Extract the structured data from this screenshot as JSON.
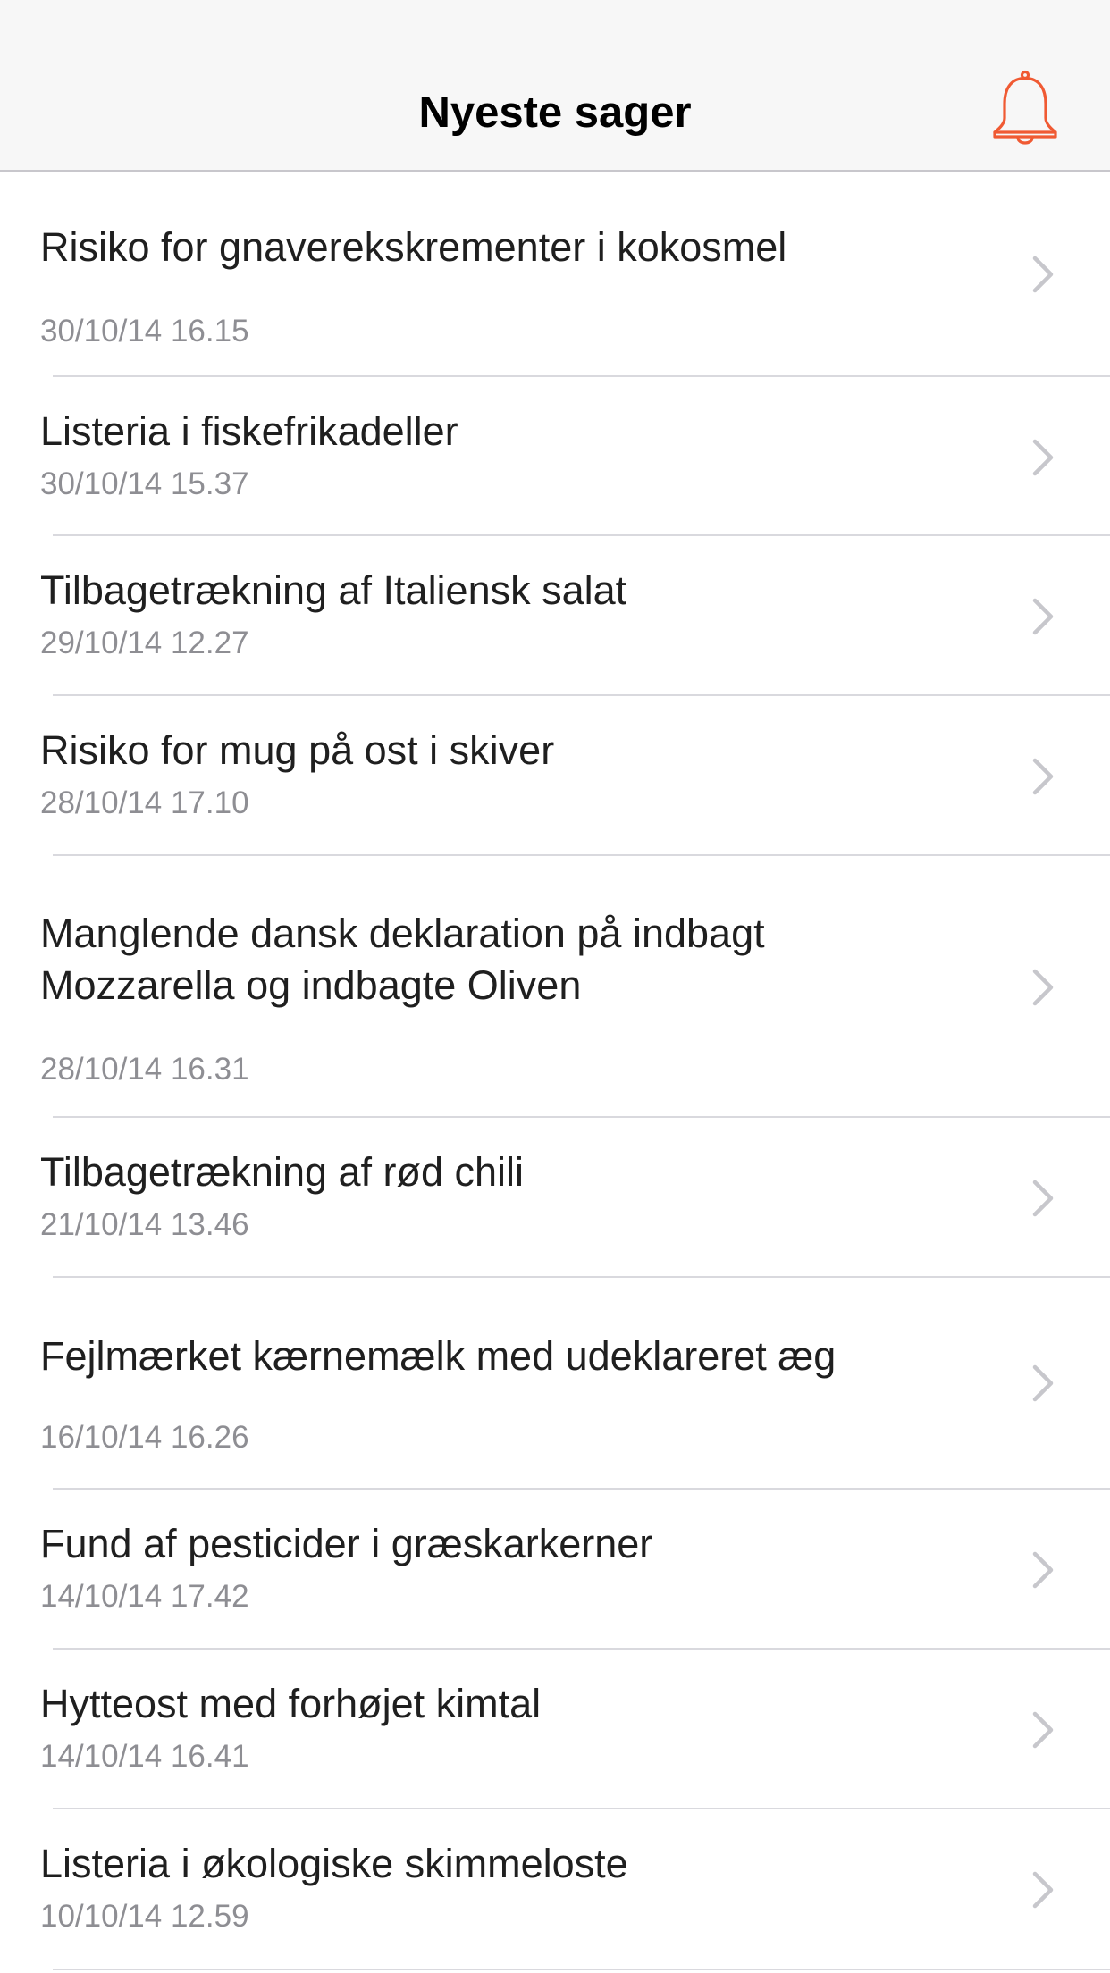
{
  "nav": {
    "title": "Nyeste sager",
    "bell_icon": "bell-icon",
    "accent_color": "#f05a33"
  },
  "cases": [
    {
      "title": "Risiko for gnaverekskrementer i kokosmel",
      "date": "30/10/14 16.15"
    },
    {
      "title": "Listeria i fiskefrikadeller",
      "date": "30/10/14 15.37"
    },
    {
      "title": "Tilbagetrækning af Italiensk salat",
      "date": "29/10/14 12.27"
    },
    {
      "title": "Risiko for mug på ost i skiver",
      "date": "28/10/14 17.10"
    },
    {
      "title": "Manglende dansk deklaration på indbagt\nMozzarella og indbagte Oliven",
      "date": "28/10/14 16.31"
    },
    {
      "title": "Tilbagetrækning af rød chili",
      "date": "21/10/14 13.46"
    },
    {
      "title": "Fejlmærket kærnemælk med udeklareret æg",
      "date": "16/10/14 16.26"
    },
    {
      "title": "Fund af pesticider i græskarkerner",
      "date": "14/10/14 17.42"
    },
    {
      "title": "Hytteost med forhøjet kimtal",
      "date": "14/10/14 16.41"
    },
    {
      "title": "Listeria i økologiske skimmeloste",
      "date": "10/10/14 12.59"
    }
  ]
}
